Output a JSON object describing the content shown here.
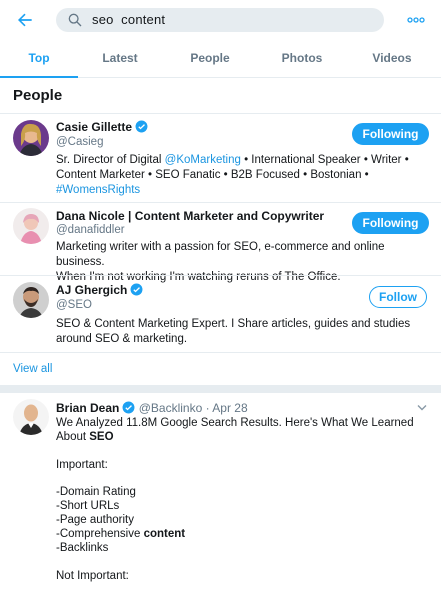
{
  "search": {
    "query": "seo  content"
  },
  "tabs": [
    "Top",
    "Latest",
    "People",
    "Photos",
    "Videos"
  ],
  "people_section": {
    "title": "People",
    "view_all": "View all"
  },
  "users": [
    {
      "name": "Casie Gillette",
      "handle": "@Casieg",
      "verified": true,
      "button": "Following",
      "bio_lines": [
        [
          "Sr. Director of Digital ",
          "@KoMarketing",
          " • International Speaker • Writer •"
        ],
        [
          "Content Marketer • SEO Fanatic • B2B Focused • Bostonian •"
        ],
        [
          "#WomensRights"
        ]
      ]
    },
    {
      "name": "Dana Nicole | Content Marketer and Copywriter",
      "handle": "@danafiddler",
      "verified": false,
      "button": "Following",
      "bio_lines": [
        [
          "Marketing writer with a passion for SEO, e-commerce and online business."
        ],
        [
          "When I'm not working I'm watching reruns of The Office."
        ]
      ]
    },
    {
      "name": "AJ Ghergich",
      "handle": "@SEO",
      "verified": true,
      "button": "Follow",
      "bio_lines": [
        [
          "SEO & Content Marketing Expert. I Share articles, guides and studies"
        ],
        [
          "around SEO & marketing."
        ]
      ]
    }
  ],
  "tweet": {
    "name": "Brian Dean",
    "handle": "@Backlinko",
    "separator": "·",
    "date": "Apr 28",
    "lines": {
      "l1": "We Analyzed 11.8M Google Search Results. Here's What We Learned",
      "l2a": "About ",
      "l2b": "SEO",
      "l3": "Important:",
      "l4": "-Domain Rating",
      "l5": "-Short URLs",
      "l6": "-Page authority",
      "l7a": "-Comprehensive ",
      "l7b": "content",
      "l8": "-Backlinks",
      "l9": "Not Important:"
    }
  },
  "colors": {
    "accent": "#1da1f2",
    "link": "#1b95e0",
    "muted": "#657786",
    "divider": "#e6ecf0"
  },
  "icons": [
    "back-arrow-icon",
    "search-icon",
    "more-icon",
    "verified-icon",
    "chevron-down-icon"
  ]
}
